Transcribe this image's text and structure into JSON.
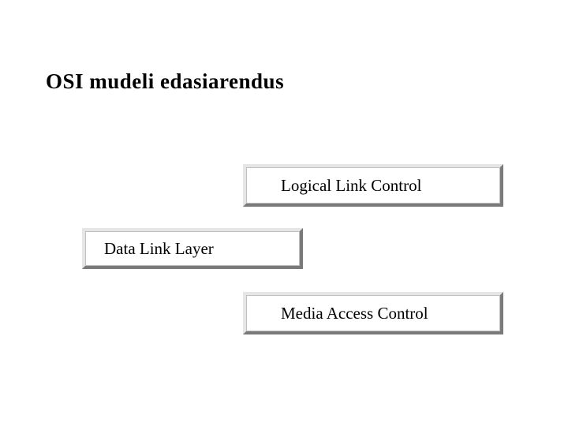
{
  "title": "OSI mudeli edasiarendus",
  "boxes": {
    "llc": "Logical Link Control",
    "dll": "Data Link Layer",
    "mac": "Media Access Control"
  }
}
